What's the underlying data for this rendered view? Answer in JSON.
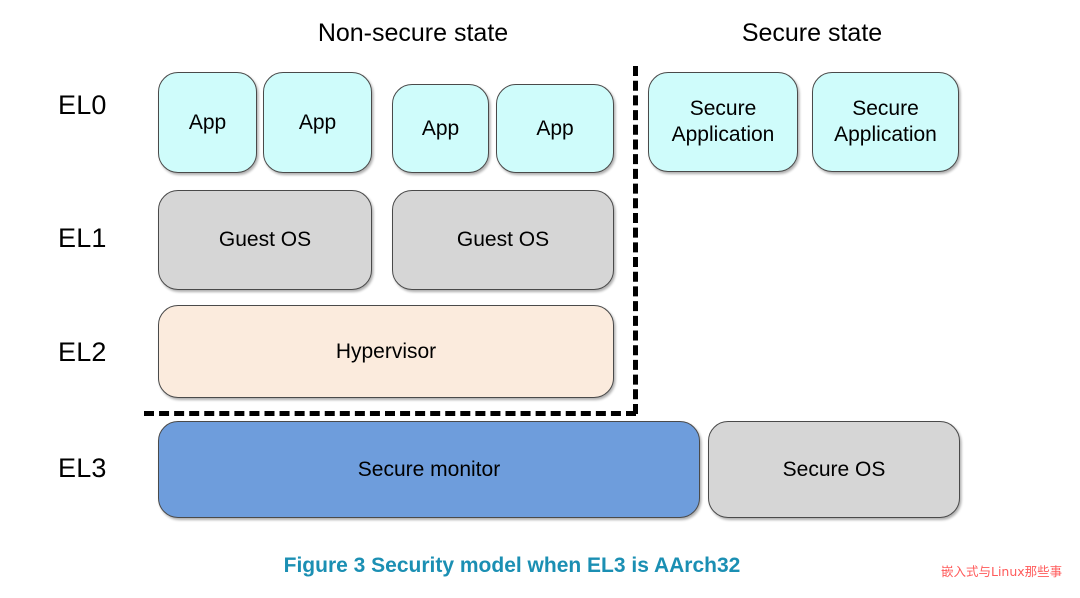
{
  "figure": {
    "caption": "Figure 3 Security model when EL3 is AArch32",
    "watermark": "嵌入式与Linux那些事",
    "caption_color": "#1b8fb3",
    "watermark_color": "#ff5a5a"
  },
  "headers": {
    "non_secure": "Non-secure state",
    "secure": "Secure state"
  },
  "exception_levels": [
    {
      "label": "EL0"
    },
    {
      "label": "EL1"
    },
    {
      "label": "EL2"
    },
    {
      "label": "EL3"
    }
  ],
  "boxes": {
    "el0_nonsecure": [
      {
        "label": "App"
      },
      {
        "label": "App"
      },
      {
        "label": "App"
      },
      {
        "label": "App"
      }
    ],
    "el0_secure": [
      {
        "line1": "Secure",
        "line2": "Application"
      },
      {
        "line1": "Secure",
        "line2": "Application"
      }
    ],
    "el1": [
      {
        "label": "Guest OS"
      },
      {
        "label": "Guest OS"
      }
    ],
    "el2": [
      {
        "label": "Hypervisor"
      }
    ],
    "el3": [
      {
        "label": "Secure monitor"
      },
      {
        "label": "Secure OS"
      }
    ]
  },
  "colors": {
    "app_fill": "#cffcfb",
    "os_fill": "#d6d6d6",
    "hypervisor_fill": "#fbebdd",
    "monitor_fill": "#6e9ddc",
    "border": "#4a4a4a",
    "divider": "#000000"
  }
}
